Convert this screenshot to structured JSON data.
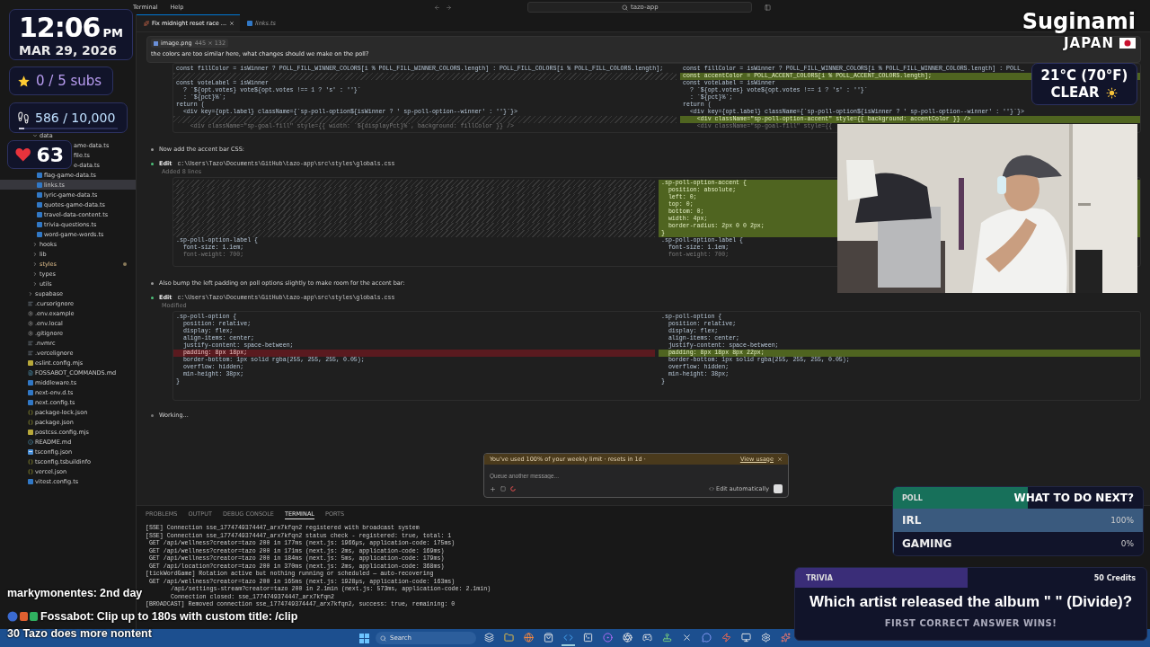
{
  "menubar": {
    "menus": [
      "Terminal",
      "Help"
    ],
    "search": "tazo-app"
  },
  "explorer": {
    "items": [
      {
        "kind": "wrapper",
        "children": [
          {
            "label": "data",
            "kind": "folder",
            "expanded": true,
            "selected": false,
            "children": [
              {
                "label": "ame-data.ts",
                "kind": "fragment"
              },
              {
                "label": "file.ts",
                "kind": "fragment"
              },
              {
                "label": "e-data.ts",
                "kind": "fragment"
              },
              {
                "label": "flag-game-data.ts",
                "kind": "ts",
                "selected": false
              },
              {
                "label": "links.ts",
                "kind": "ts",
                "selected": true
              },
              {
                "label": "lyric-game-data.ts",
                "kind": "ts",
                "selected": false
              },
              {
                "label": "quotes-game-data.ts",
                "kind": "ts",
                "selected": false
              },
              {
                "label": "travel-data-content.ts",
                "kind": "ts",
                "selected": false
              },
              {
                "label": "trivia-questions.ts",
                "kind": "ts",
                "selected": false
              },
              {
                "label": "word-game-words.ts",
                "kind": "ts",
                "selected": false
              }
            ]
          },
          {
            "label": "hooks",
            "kind": "folder",
            "expanded": false,
            "selected": false
          },
          {
            "label": "lib",
            "kind": "folder",
            "expanded": false,
            "selected": false
          },
          {
            "label": "styles",
            "kind": "folder",
            "expanded": false,
            "selected": false,
            "modified": true
          },
          {
            "label": "types",
            "kind": "folder",
            "expanded": false,
            "selected": false
          },
          {
            "label": "utils",
            "kind": "folder",
            "expanded": false,
            "selected": false
          }
        ]
      },
      {
        "label": "supabase",
        "kind": "folder",
        "expanded": false,
        "selected": false
      },
      {
        "label": ".cursorignore",
        "kind": "text",
        "selected": false
      },
      {
        "label": ".env.example",
        "kind": "gear",
        "selected": false
      },
      {
        "label": ".env.local",
        "kind": "gear",
        "selected": false
      },
      {
        "label": ".gitignore",
        "kind": "gear",
        "selected": false
      },
      {
        "label": ".nvmrc",
        "kind": "text",
        "selected": false
      },
      {
        "label": ".vercelignore",
        "kind": "text",
        "selected": false
      },
      {
        "label": "eslint.config.mjs",
        "kind": "js",
        "selected": false
      },
      {
        "label": "FOSSABOT_COMMANDS.md",
        "kind": "md",
        "selected": false
      },
      {
        "label": "middleware.ts",
        "kind": "ts",
        "selected": false
      },
      {
        "label": "next-env.d.ts",
        "kind": "ts",
        "selected": false
      },
      {
        "label": "next.config.ts",
        "kind": "ts",
        "selected": false
      },
      {
        "label": "package-lock.json",
        "kind": "json",
        "selected": false
      },
      {
        "label": "package.json",
        "kind": "json",
        "selected": false
      },
      {
        "label": "postcss.config.mjs",
        "kind": "js",
        "selected": false
      },
      {
        "label": "README.md",
        "kind": "info",
        "selected": false
      },
      {
        "label": "tsconfig.json",
        "kind": "tsconfig",
        "selected": false
      },
      {
        "label": "tsconfig.tsbuildinfo",
        "kind": "json",
        "selected": false
      },
      {
        "label": "vercel.json",
        "kind": "json",
        "selected": false
      },
      {
        "label": "vitest.config.ts",
        "kind": "ts",
        "selected": false
      }
    ]
  },
  "editor_tabs": [
    {
      "label": "Fix midnight reset race ...",
      "kind": "chat",
      "selected": true
    },
    {
      "label": "links.ts",
      "kind": "ts",
      "selected": false
    }
  ],
  "chat": {
    "attachment": {
      "name": "image.png",
      "size": "445 × 132"
    },
    "prompt": "the colors are too similar here, what changes should we make on the poll?",
    "entries": [
      {
        "kind": "diff",
        "diff": {
          "left": [
            {
              "kind": "normal",
              "text": "const fillColor = isWinner ? POLL_FILL_WINNER_COLORS[i % POLL_FILL_WINNER_COLORS.length] : POLL_FILL_COLORS[i % POLL_FILL_COLORS.length];"
            },
            {
              "kind": "gap"
            },
            {
              "kind": "normal",
              "text": "const voteLabel = isWinner"
            },
            {
              "kind": "normal",
              "text": "  ? `${opt.votes} vote${opt.votes !== 1 ? 's' : ''}`"
            },
            {
              "kind": "normal",
              "text": "  : `${pct}%`;"
            },
            {
              "kind": "normal",
              "text": "return ("
            },
            {
              "kind": "normal",
              "text": "  <div key={opt.label} className={`sp-poll-option${isWinner ? ' sp-poll-option--winner' : ''}`}>"
            },
            {
              "kind": "gap"
            },
            {
              "kind": "dim",
              "text": "    <div className=\"sp-goal-fill\" style={{ width: `${displayPct}%`, background: fillColor }} />"
            }
          ],
          "right": [
            {
              "kind": "normal",
              "text": "const fillColor = isWinner ? POLL_FILL_WINNER_COLORS[i % POLL_FILL_WINNER_COLORS.length] : POLL_"
            },
            {
              "kind": "added",
              "text": "const accentColor = POLL_ACCENT_COLORS[i % POLL_ACCENT_COLORS.length];"
            },
            {
              "kind": "normal",
              "text": "const voteLabel = isWinner"
            },
            {
              "kind": "normal",
              "text": "  ? `${opt.votes} vote${opt.votes !== 1 ? 's' : ''}`"
            },
            {
              "kind": "normal",
              "text": "  : `${pct}%`;"
            },
            {
              "kind": "normal",
              "text": "return ("
            },
            {
              "kind": "normal",
              "text": "  <div key={opt.label} className={`sp-poll-option${isWinner ? ' sp-poll-option--winner' : ''}`}>"
            },
            {
              "kind": "added",
              "text": "    <div className=\"sp-poll-option-accent\" style={{ background: accentColor }} />"
            },
            {
              "kind": "dim",
              "text": "    <div className=\"sp-goal-fill\" style={{"
            }
          ]
        }
      },
      {
        "kind": "note",
        "text": "Now add the accent bar CSS:"
      },
      {
        "kind": "edit",
        "label": "Edit",
        "path": "c:\\Users\\Tazo\\Documents\\GitHub\\tazo-app\\src\\styles\\globals.css",
        "status": "Added 8 lines",
        "diff": {
          "left": [
            {
              "kind": "gap"
            },
            {
              "kind": "gap"
            },
            {
              "kind": "gap"
            },
            {
              "kind": "gap"
            },
            {
              "kind": "gap"
            },
            {
              "kind": "gap"
            },
            {
              "kind": "gap"
            },
            {
              "kind": "gap"
            },
            {
              "kind": "normal",
              "text": ".sp-poll-option-label {"
            },
            {
              "kind": "normal",
              "text": "  font-size: 1.1em;"
            },
            {
              "kind": "dim",
              "text": "  font-weight: 700;"
            }
          ],
          "right": [
            {
              "kind": "added",
              "text": ".sp-poll-option-accent {"
            },
            {
              "kind": "added",
              "text": "  position: absolute;"
            },
            {
              "kind": "added",
              "text": "  left: 0;"
            },
            {
              "kind": "added",
              "text": "  top: 0;"
            },
            {
              "kind": "added",
              "text": "  bottom: 0;"
            },
            {
              "kind": "added",
              "text": "  width: 4px;"
            },
            {
              "kind": "added",
              "text": "  border-radius: 2px 0 0 2px;"
            },
            {
              "kind": "added",
              "text": "}"
            },
            {
              "kind": "normal",
              "text": ".sp-poll-option-label {"
            },
            {
              "kind": "normal",
              "text": "  font-size: 1.1em;"
            },
            {
              "kind": "dim",
              "text": "  font-weight: 700;"
            }
          ]
        }
      },
      {
        "kind": "note",
        "text": "Also bump the left padding on poll options slightly to make room for the accent bar:"
      },
      {
        "kind": "edit",
        "label": "Edit",
        "path": "c:\\Users\\Tazo\\Documents\\GitHub\\tazo-app\\src\\styles\\globals.css",
        "status": "Modified",
        "diff": {
          "left": [
            {
              "kind": "normal",
              "text": ".sp-poll-option {"
            },
            {
              "kind": "normal",
              "text": "  position: relative;"
            },
            {
              "kind": "normal",
              "text": "  display: flex;"
            },
            {
              "kind": "normal",
              "text": "  align-items: center;"
            },
            {
              "kind": "normal",
              "text": "  justify-content: space-between;"
            },
            {
              "kind": "removed",
              "text": "  padding: 8px 18px;"
            },
            {
              "kind": "normal",
              "text": "  border-bottom: 1px solid rgba(255, 255, 255, 0.05);"
            },
            {
              "kind": "normal",
              "text": "  overflow: hidden;"
            },
            {
              "kind": "normal",
              "text": "  min-height: 38px;"
            },
            {
              "kind": "normal",
              "text": "}"
            }
          ],
          "right": [
            {
              "kind": "normal",
              "text": ".sp-poll-option {"
            },
            {
              "kind": "normal",
              "text": "  position: relative;"
            },
            {
              "kind": "normal",
              "text": "  display: flex;"
            },
            {
              "kind": "normal",
              "text": "  align-items: center;"
            },
            {
              "kind": "normal",
              "text": "  justify-content: space-between;"
            },
            {
              "kind": "added",
              "text": "  padding: 8px 18px 8px 22px;"
            },
            {
              "kind": "normal",
              "text": "  border-bottom: 1px solid rgba(255, 255, 255, 0.05);"
            },
            {
              "kind": "normal",
              "text": "  overflow: hidden;"
            },
            {
              "kind": "normal",
              "text": "  min-height: 38px;"
            },
            {
              "kind": "normal",
              "text": "}"
            }
          ]
        }
      },
      {
        "kind": "status",
        "text": "Working..."
      }
    ],
    "composer": {
      "warning": "You've used 100% of your weekly limit · resets in 1d ·",
      "link": "View usage",
      "placeholder": "Queue another message...",
      "mode": "Edit automatically"
    }
  },
  "panel": {
    "tabs": [
      {
        "label": "PROBLEMS",
        "selected": false
      },
      {
        "label": "OUTPUT",
        "selected": false
      },
      {
        "label": "DEBUG CONSOLE",
        "selected": false
      },
      {
        "label": "TERMINAL",
        "selected": true
      },
      {
        "label": "PORTS",
        "selected": false
      }
    ],
    "lines": [
      {
        "kind": "full",
        "text": "[SSE] Connection sse_1774749374447_arx7kfqn2 registered with broadcast system"
      },
      {
        "kind": "full",
        "text": "[SSE] Connection sse_1774749374447_arx7kfqn2 status check - registered: true, total: 1"
      },
      {
        "kind": "full",
        "text": " GET /api/wellness?creator=tazo 200 in 177ms (next.js: 1966µs, application-code: 175ms)"
      },
      {
        "kind": "full",
        "text": " GET /api/wellness?creator=tazo 200 in 171ms (next.js: 2ms, application-code: 169ms)"
      },
      {
        "kind": "full",
        "text": " GET /api/wellness?creator=tazo 200 in 184ms (next.js: 5ms, application-code: 179ms)"
      },
      {
        "kind": "full",
        "text": " GET /api/location?creator=tazo 200 in 370ms (next.js: 2ms, application-code: 368ms)"
      },
      {
        "kind": "full",
        "text": "[tickWordGame] Rotation active but nothing running or scheduled — auto-recovering"
      },
      {
        "kind": "full",
        "text": " GET /api/wellness?creator=tazo 200 in 165ms (next.js: 1928µs, application-code: 163ms)"
      },
      {
        "kind": "covered",
        "text": "/api/settings-stream?creator=tazo 200 in 2.1min (next.js: 573ms, application-code: 2.1min)"
      },
      {
        "kind": "covered",
        "text": "Connection closed: sse_1774749374447_arx7kfqn2"
      },
      {
        "kind": "full",
        "text": "[BROADCAST] Removed connection sse_1774749374447_arx7kfqn2, success: true, remaining: 0"
      }
    ]
  },
  "taskbar": {
    "search": "Search",
    "apps": [
      {
        "kind": "layers",
        "active": false
      },
      {
        "kind": "folder",
        "active": false
      },
      {
        "kind": "globe",
        "active": false
      },
      {
        "kind": "bag",
        "active": false
      },
      {
        "kind": "code",
        "active": true
      },
      {
        "kind": "terminal",
        "active": false
      },
      {
        "kind": "dot",
        "active": false
      },
      {
        "kind": "aperture",
        "active": false
      },
      {
        "kind": "gamepad",
        "active": false
      },
      {
        "kind": "joystick",
        "active": false
      },
      {
        "kind": "close",
        "active": false
      },
      {
        "kind": "message",
        "active": false
      },
      {
        "kind": "zap",
        "active": false
      },
      {
        "kind": "monitor",
        "active": false
      },
      {
        "kind": "gear",
        "active": false
      },
      {
        "kind": "sparkles",
        "active": false
      }
    ]
  },
  "stream": {
    "clock": {
      "time": "12:06",
      "ampm": "PM",
      "date": "MAR 29, 2026"
    },
    "subs": "0 / 5 subs",
    "steps": {
      "text": "586 / 10,000",
      "level": 0.0586
    },
    "hearts": "63",
    "location": {
      "city": "Suginami",
      "country": "JAPAN"
    },
    "weather": {
      "temp": "21°C (70°F)",
      "sky": "CLEAR"
    },
    "poll": {
      "label": "POLL",
      "title": "WHAT TO DO NEXT?",
      "level": 0.54,
      "options": [
        {
          "label": "IRL",
          "reading": "100%",
          "level": 1
        },
        {
          "label": "GAMING",
          "reading": "0%",
          "level": 0
        }
      ]
    },
    "trivia": {
      "label": "TRIVIA",
      "reward": "50 Credits",
      "level": 0.49,
      "question": "Which artist released the album \" \" (Divide)?",
      "footer": "FIRST CORRECT ANSWER WINS!"
    },
    "chat": [
      {
        "kind": "plain",
        "user": "markymonentes:",
        "text": "2nd day"
      },
      {
        "kind": "badged",
        "user": "Fossabot:",
        "text": "Clip up to 180s with custom title: /clip"
      },
      {
        "kind": "plain",
        "text": "30 Tazo does more nontent"
      }
    ]
  }
}
